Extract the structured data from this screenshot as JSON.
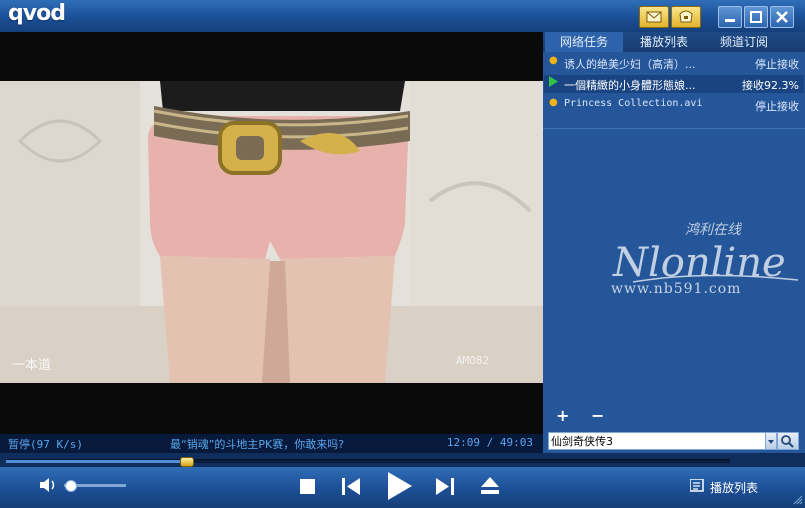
{
  "app": {
    "logo": "qvod"
  },
  "icons": {
    "skin": "skin-icon",
    "message": "message-icon",
    "minimize": "minimize-icon",
    "maximize": "maximize-icon",
    "close": "close-icon",
    "volume": "volume-icon",
    "stop": "stop-icon",
    "previous": "previous-icon",
    "play": "play-icon",
    "next": "next-icon",
    "eject": "eject-icon",
    "playlist": "playlist-icon",
    "search": "search-icon"
  },
  "video": {
    "watermark_left": "一本道",
    "watermark_right": "AMO82"
  },
  "status": {
    "state": "暂停(97 K/s)",
    "marquee": "最“销魂”的斗地主PK赛，你敢来吗?",
    "time": "12:09 / 49:03"
  },
  "panel": {
    "tabs": [
      {
        "label": "网络任务"
      },
      {
        "label": "播放列表"
      },
      {
        "label": "频道订阅"
      }
    ],
    "tasks": [
      {
        "name": "诱人的绝美少妇（高清）...",
        "status": "停止接收"
      },
      {
        "name": "一個精緻的小身體形態娘...",
        "status": "接收92.3%"
      },
      {
        "name": "Princess Collection.avi",
        "status": "停止接收"
      }
    ],
    "site_logo": "Nlonline",
    "site_cn": "鸿利在线",
    "site_url": "www.nb591.com",
    "add_label": "+",
    "remove_label": "−",
    "search_value": "仙剑奇侠传3"
  },
  "progress": {
    "played_fraction": 0.248
  },
  "volume": {
    "level": 0.1
  },
  "controls": {
    "playlist_label": "播放列表"
  },
  "colors": {
    "accent": "#2d63ab",
    "title_bar": "#1b4f96",
    "status_text": "#5ba6ec",
    "task_marker": "#f3b313",
    "playing_marker": "#2fc34a"
  }
}
